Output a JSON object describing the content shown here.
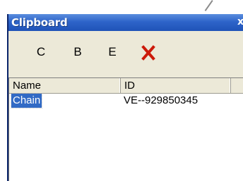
{
  "window": {
    "title": "Clipboard",
    "close_glyph": "x"
  },
  "toolbar": {
    "buttons": [
      {
        "label": "C"
      },
      {
        "label": "B"
      },
      {
        "label": "E"
      },
      {
        "label": "",
        "icon": "delete-x-icon",
        "color": "#cc1a0a"
      }
    ]
  },
  "list": {
    "columns": [
      "Name",
      "ID",
      ""
    ],
    "rows": [
      {
        "name": "Chain",
        "id": "VE--929850345",
        "selected": true
      }
    ]
  },
  "colors": {
    "titlebar": "#2e64c9",
    "window_bg": "#ece9d8",
    "selection": "#316ac5"
  }
}
